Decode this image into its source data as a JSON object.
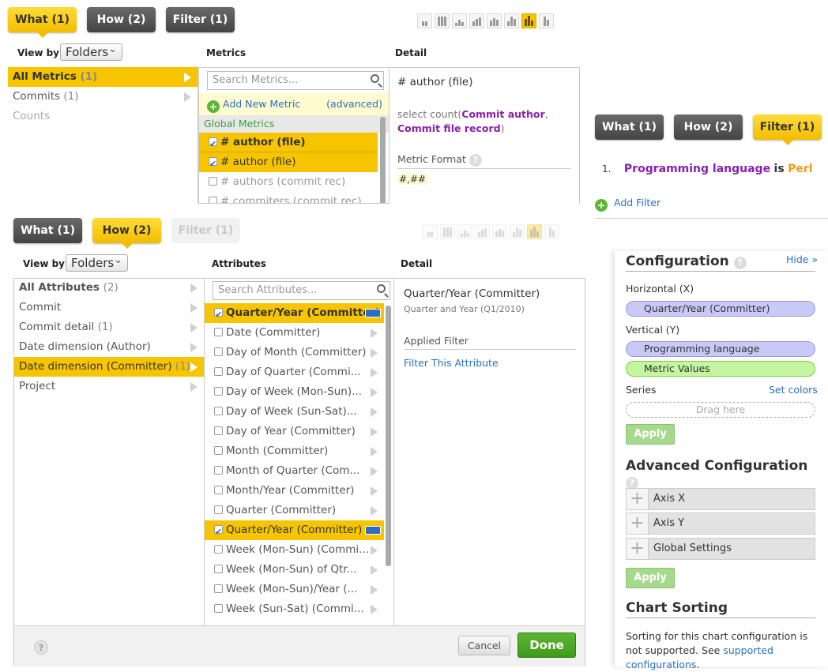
{
  "tabs_top": {
    "what": "What (1)",
    "how": "How (2)",
    "filter": "Filter (1)"
  },
  "tabs_right": {
    "what": "What (1)",
    "how": "How (2)",
    "filter": "Filter (1)"
  },
  "tabs_bottom": {
    "what": "What (1)",
    "how": "How (2)",
    "filter": "Filter (1)"
  },
  "chart_types": [
    "table-123-icon",
    "grid-table-icon",
    "line-chart-icon",
    "area-chart-icon",
    "stacked-area-icon",
    "bar-chart-icon",
    "stacked-bar-icon",
    "column-chart-icon"
  ],
  "metrics_view": {
    "view_by_label": "View by",
    "view_by_value": "Folders",
    "metrics_header": "Metrics",
    "detail_header": "Detail",
    "folders": [
      {
        "label": "All Metrics",
        "count": "(1)",
        "selected": true
      },
      {
        "label": "Commits",
        "count": "(1)",
        "selected": false
      },
      {
        "label": "Counts",
        "count": "",
        "selected": false
      }
    ],
    "search_placeholder": "Search Metrics...",
    "add_new": "Add New Metric",
    "advanced": "(advanced)",
    "group": "Global Metrics",
    "items": [
      {
        "label": "# author (file)",
        "checked": true,
        "bold": true
      },
      {
        "label": "# author (file)",
        "checked": true,
        "bold": false
      },
      {
        "label": "# authors (commit rec)",
        "checked": false,
        "bold": false
      },
      {
        "label": "# commiters (commit rec)",
        "checked": false,
        "bold": false
      }
    ],
    "detail_title": "# author (file)",
    "detail_query_prefix": "select count(",
    "detail_query_a": "Commit author",
    "detail_query_sep": ", ",
    "detail_query_b": "Commit file record",
    "detail_query_suffix": ")",
    "metric_format_label": "Metric Format",
    "metric_format_value": "#,##"
  },
  "filter_view": {
    "number": "1.",
    "attribute": "Programming language",
    "is": "is",
    "value": "Perl",
    "add_filter": "Add Filter"
  },
  "attributes_view": {
    "view_by_label": "View by",
    "view_by_value": "Folders",
    "attributes_header": "Attributes",
    "detail_header": "Detail",
    "folders": [
      {
        "label": "All Attributes",
        "count": "(2)",
        "selected": false,
        "bold": true
      },
      {
        "label": "Commit",
        "count": "",
        "selected": false,
        "bold": false
      },
      {
        "label": "Commit detail",
        "count": "(1)",
        "selected": false,
        "bold": false
      },
      {
        "label": "Date dimension (Author)",
        "count": "",
        "selected": false,
        "bold": false
      },
      {
        "label": "Date dimension (Committer)",
        "count": "(1)",
        "selected": true,
        "bold": false
      },
      {
        "label": "Project",
        "count": "",
        "selected": false,
        "bold": false
      }
    ],
    "search_placeholder": "Search Attributes...",
    "items": [
      {
        "label": "Quarter/Year (Committer)",
        "checked": true,
        "selected": true,
        "bold": true
      },
      {
        "label": "Date (Committer)",
        "checked": false,
        "selected": false,
        "bold": false
      },
      {
        "label": "Day of Month (Committer)",
        "checked": false,
        "selected": false,
        "bold": false
      },
      {
        "label": "Day of Quarter (Commi...",
        "checked": false,
        "selected": false,
        "bold": false
      },
      {
        "label": "Day of Week (Mon-Sun)...",
        "checked": false,
        "selected": false,
        "bold": false
      },
      {
        "label": "Day of Week (Sun-Sat)...",
        "checked": false,
        "selected": false,
        "bold": false
      },
      {
        "label": "Day of Year (Committer)",
        "checked": false,
        "selected": false,
        "bold": false
      },
      {
        "label": "Month (Committer)",
        "checked": false,
        "selected": false,
        "bold": false
      },
      {
        "label": "Month of Quarter (Com...",
        "checked": false,
        "selected": false,
        "bold": false
      },
      {
        "label": "Month/Year (Committer)",
        "checked": false,
        "selected": false,
        "bold": false
      },
      {
        "label": "Quarter (Committer)",
        "checked": false,
        "selected": false,
        "bold": false
      },
      {
        "label": "Quarter/Year (Committer)",
        "checked": true,
        "selected": true,
        "bold": false
      },
      {
        "label": "Week (Mon-Sun) (Commi...",
        "checked": false,
        "selected": false,
        "bold": false
      },
      {
        "label": "Week (Mon-Sun) of Qtr...",
        "checked": false,
        "selected": false,
        "bold": false
      },
      {
        "label": "Week (Mon-Sun)/Year (...",
        "checked": false,
        "selected": false,
        "bold": false
      },
      {
        "label": "Week (Sun-Sat) (Commi...",
        "checked": false,
        "selected": false,
        "bold": false
      }
    ],
    "detail_title": "Quarter/Year (Committer)",
    "detail_sub": "Quarter and Year (Q1/2010)",
    "applied_filter_label": "Applied Filter",
    "filter_link": "Filter This Attribute",
    "cancel": "Cancel",
    "done": "Done"
  },
  "configuration": {
    "title": "Configuration",
    "hide": "Hide »",
    "horizontal_label": "Horizontal (X)",
    "horizontal_item": "Quarter/Year (Committer)",
    "vertical_label": "Vertical (Y)",
    "vertical_items": [
      "Programming language",
      "Metric Values"
    ],
    "series_label": "Series",
    "set_colors": "Set colors",
    "drag_here": "Drag here",
    "apply": "Apply",
    "advanced_title": "Advanced Configuration",
    "advanced_items": [
      "Axis X",
      "Axis Y",
      "Global Settings"
    ],
    "apply2": "Apply",
    "sorting_title": "Chart Sorting",
    "sorting_text": "Sorting for this chart configuration is not supported. See",
    "sorting_link": "supported configurations",
    "sorting_end": "."
  },
  "colors": {
    "accent": "#f6c500",
    "tab_dark": "#4f4f4f",
    "purple": "#8a1faa",
    "orange": "#f29a1c",
    "link": "#2a6fc6",
    "done_green": "#3f9c1a"
  }
}
